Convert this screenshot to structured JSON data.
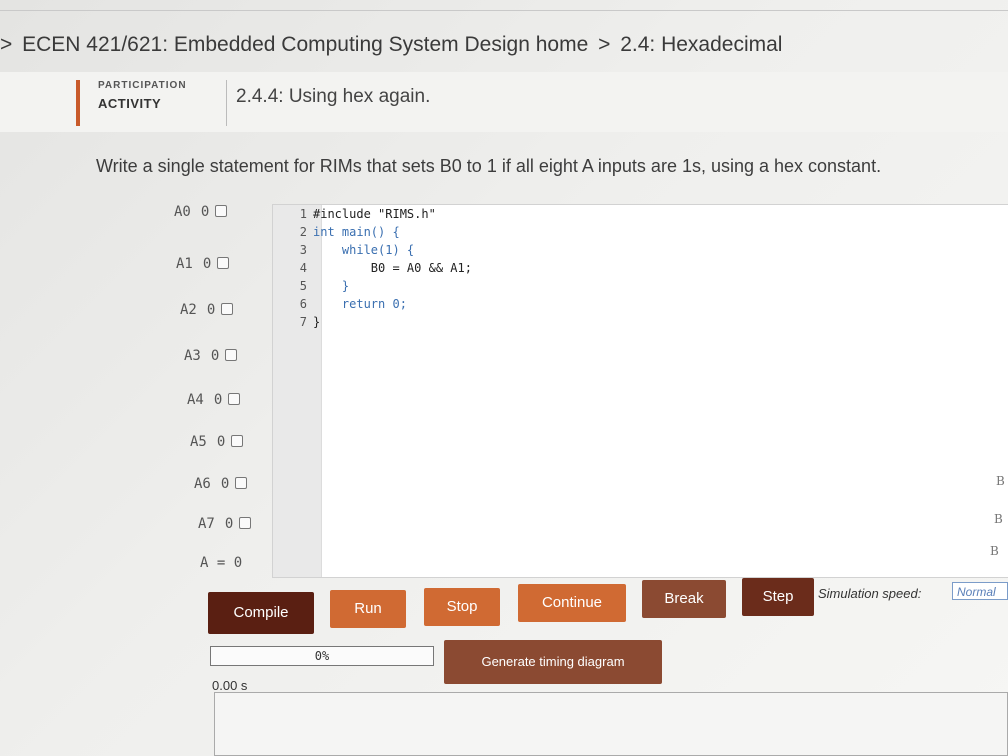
{
  "breadcrumb": {
    "arrow1": ">",
    "course": "ECEN 421/621: Embedded Computing System Design home",
    "arrow2": ">",
    "section": "2.4: Hexadecimal"
  },
  "activity": {
    "type_small": "PARTICIPATION",
    "type_label": "ACTIVITY",
    "title": "2.4.4: Using hex again."
  },
  "prompt": "Write a single statement for RIMs that sets B0 to 1 if all eight A inputs are 1s, using a hex constant.",
  "inputs": [
    {
      "name": "A0",
      "value": "0"
    },
    {
      "name": "A1",
      "value": "0"
    },
    {
      "name": "A2",
      "value": "0"
    },
    {
      "name": "A3",
      "value": "0"
    },
    {
      "name": "A4",
      "value": "0"
    },
    {
      "name": "A5",
      "value": "0"
    },
    {
      "name": "A6",
      "value": "0"
    },
    {
      "name": "A7",
      "value": "0"
    }
  ],
  "total": {
    "label": "A",
    "eq": "=",
    "value": "0"
  },
  "editor": {
    "line_numbers": [
      "1",
      "2",
      "3",
      "4",
      "5",
      "6",
      "7"
    ],
    "lines": [
      "#include \"RIMS.h\"",
      "int main() {",
      "    while(1) {",
      "        B0 = A0 && A1;",
      "    }",
      "    return 0;",
      "}"
    ]
  },
  "outputs": {
    "b_labels": [
      "B",
      "B",
      "B"
    ]
  },
  "buttons": {
    "compile": "Compile",
    "run": "Run",
    "stop": "Stop",
    "continue": "Continue",
    "break": "Break",
    "step": "Step",
    "generate": "Generate timing diagram"
  },
  "simulation": {
    "speed_label": "Simulation speed:",
    "speed_value": "Normal",
    "progress_text": "0%",
    "progress": 0,
    "time": "0.00 s"
  },
  "colors": {
    "accent": "#c85a2a",
    "compile_bg": "#5a1f12",
    "button_orange": "#d06a33"
  }
}
